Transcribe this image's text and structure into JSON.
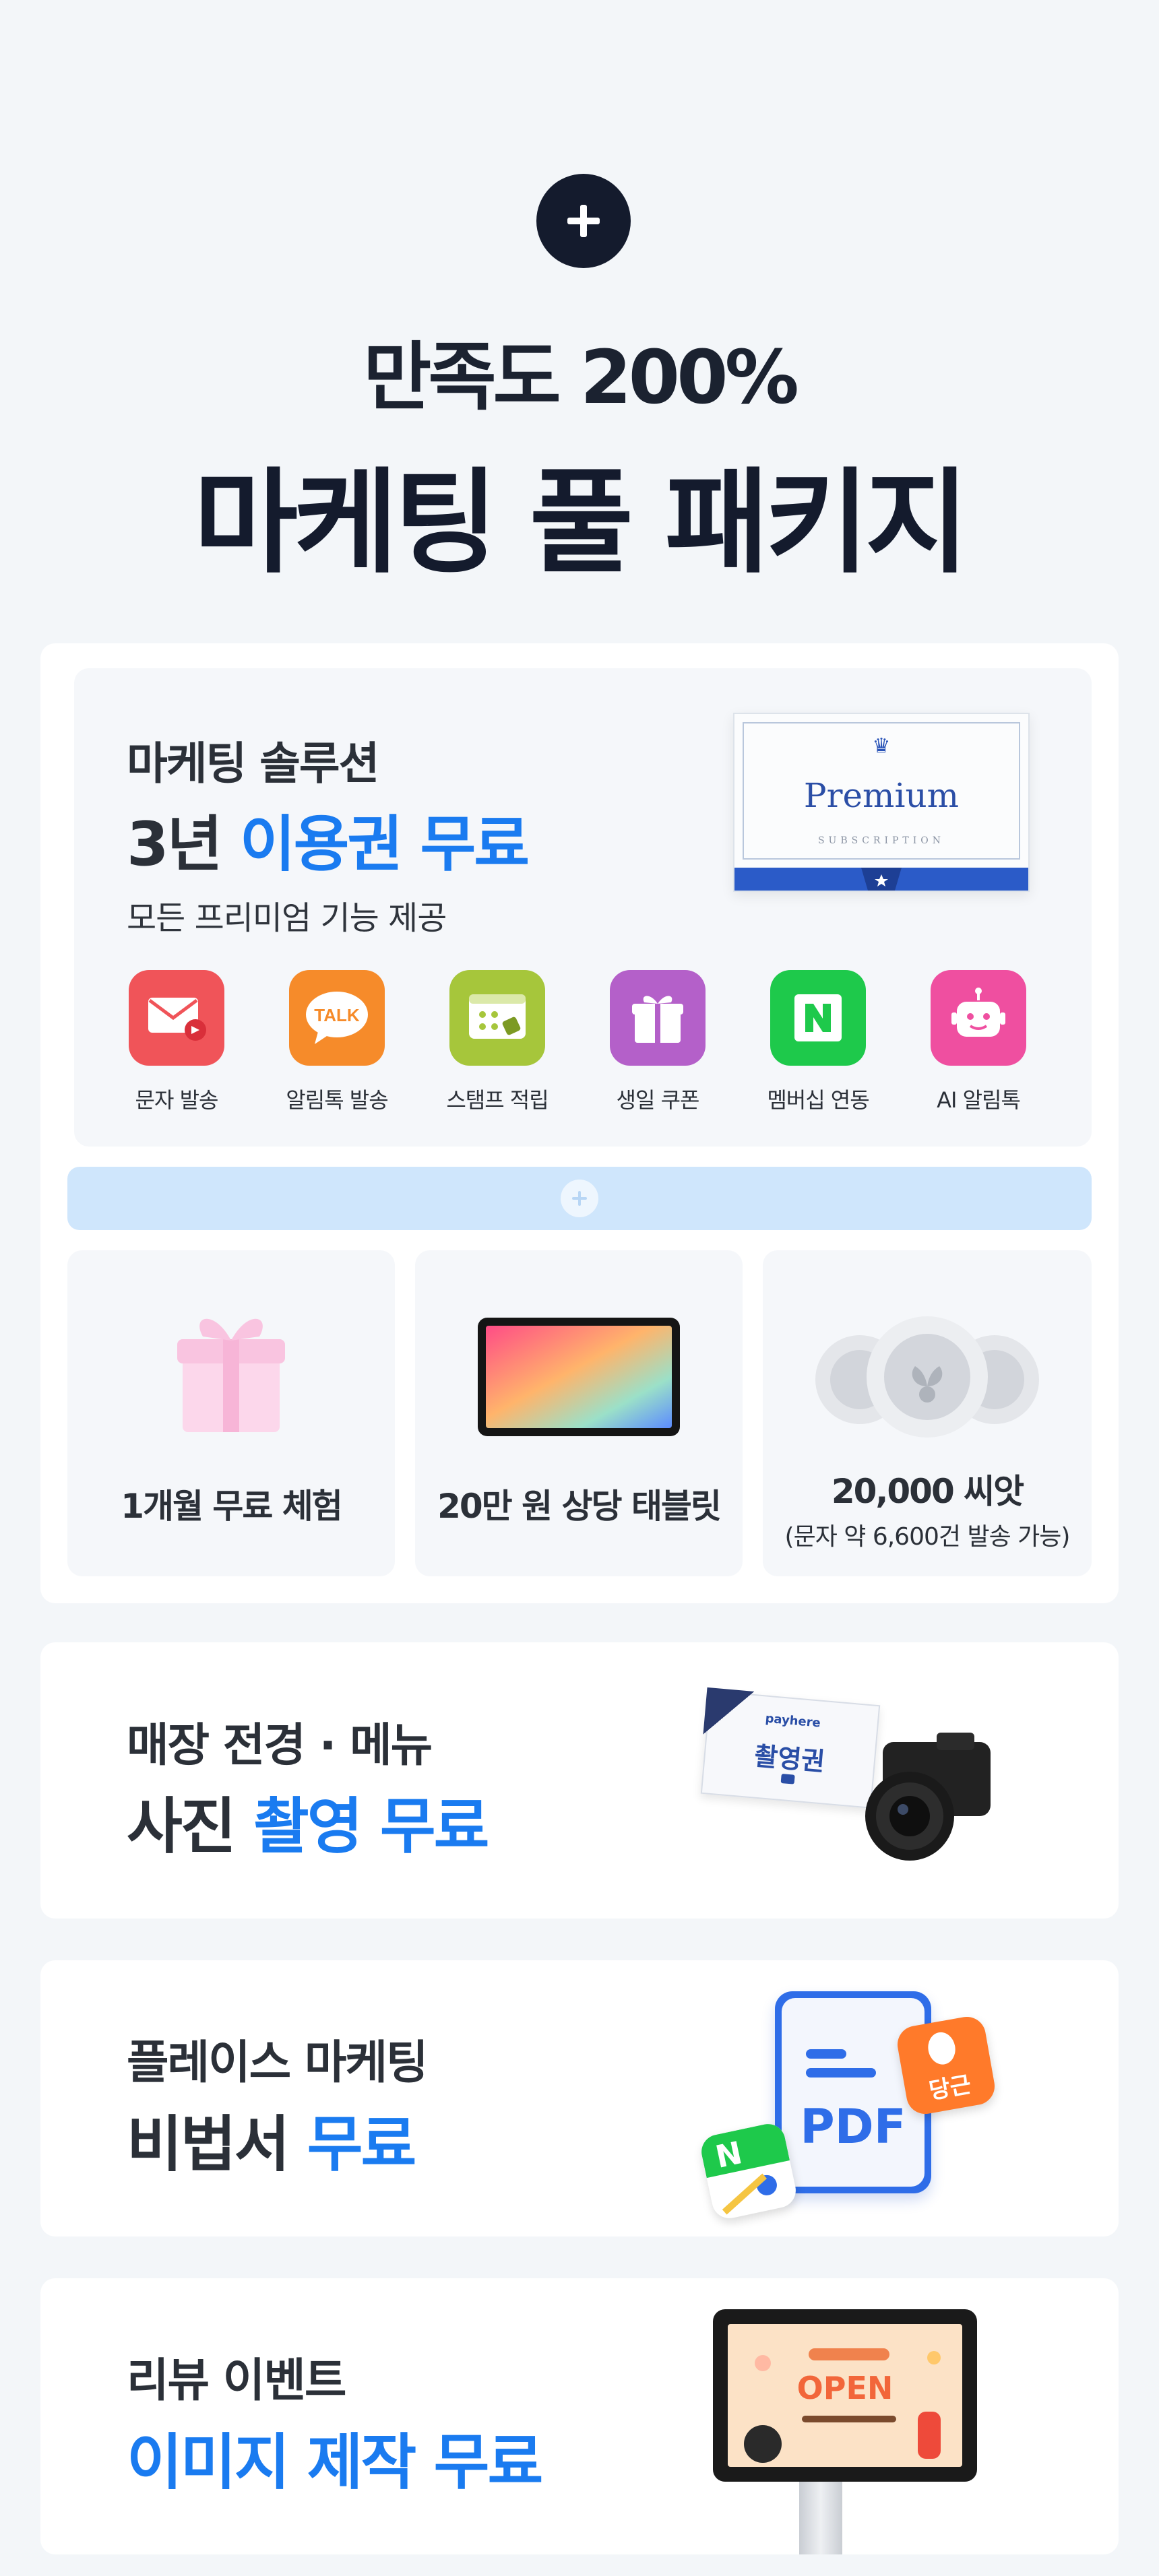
{
  "hero": {
    "subtitle": "만족도 200%",
    "title": "마케팅 풀 패키지"
  },
  "solution": {
    "line1": "마케팅 솔루션",
    "line2_prefix": "3년 ",
    "line2_accent": "이용권 무료",
    "line3": "모든 프리미엄 기능 제공",
    "card": {
      "title": "Premium",
      "subtitle": "SUBSCRIPTION"
    },
    "features": [
      {
        "label": "문자 발송",
        "icon": "sms-envelope-icon",
        "color": "#f05459"
      },
      {
        "label": "알림톡 발송",
        "icon": "talk-bubble-icon",
        "color": "#f68b2a"
      },
      {
        "label": "스탬프 적립",
        "icon": "stamp-card-icon",
        "color": "#a6c63b"
      },
      {
        "label": "생일 쿠폰",
        "icon": "gift-icon",
        "color": "#b460c9"
      },
      {
        "label": "멤버십 연동",
        "icon": "naver-n-icon",
        "color": "#1ec94b"
      },
      {
        "label": "AI 알림톡",
        "icon": "robot-icon",
        "color": "#ef4fa0"
      }
    ]
  },
  "bonuses": [
    {
      "label": "1개월 무료 체험",
      "icon": "gift-box-icon"
    },
    {
      "label": "20만 원 상당 태블릿",
      "icon": "tablet-icon"
    },
    {
      "label": "20,000 씨앗",
      "note": "(문자 약 6,600건 발송 가능)",
      "icon": "seed-coins-icon"
    }
  ],
  "promos": [
    {
      "line1": "매장 전경 · 메뉴",
      "line2_prefix": "사진 ",
      "line2_accent": "촬영 무료",
      "ticket_brand": "payhere",
      "ticket_text": "촬영권"
    },
    {
      "line1": "플레이스 마케팅",
      "line2_prefix": "비법서 ",
      "line2_accent": "무료",
      "pdf_text": "PDF",
      "badge_text": "당근"
    },
    {
      "line1": "리뷰 이벤트",
      "line2_prefix": "",
      "line2_accent": "이미지 제작 무료",
      "screen_text": "OPEN"
    }
  ],
  "colors": {
    "accent": "#1a7bf0",
    "navy": "#141b2d",
    "page_bg": "#f3f6f9",
    "strip": "#cfe6fc"
  }
}
